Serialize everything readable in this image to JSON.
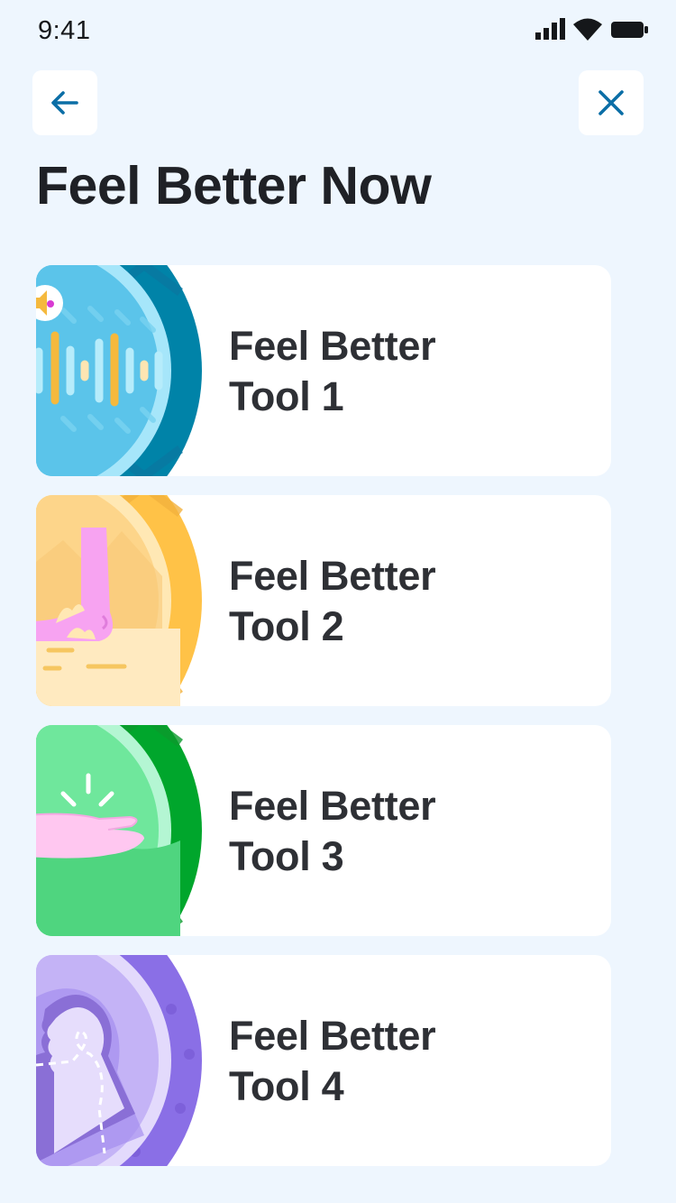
{
  "status_bar": {
    "time": "9:41",
    "icons": [
      "cellular-signal-icon",
      "wifi-icon",
      "battery-icon"
    ]
  },
  "nav": {
    "back_icon": "arrow-left-icon",
    "close_icon": "close-icon"
  },
  "page": {
    "title": "Feel Better Now"
  },
  "tools": [
    {
      "line1": "Feel Better",
      "line2": "Tool 1",
      "icon": "sound-wave-icon",
      "color": "#0083a8"
    },
    {
      "line1": "Feel Better",
      "line2": "Tool 2",
      "icon": "foot-on-ground-icon",
      "color": "#ffc247"
    },
    {
      "line1": "Feel Better",
      "line2": "Tool 3",
      "icon": "open-hand-icon",
      "color": "#00a62c"
    },
    {
      "line1": "Feel Better",
      "line2": "Tool 4",
      "icon": "head-profile-icon",
      "color": "#8a6fe6"
    }
  ],
  "colors": {
    "background": "#eef6fe",
    "card": "#ffffff",
    "accent": "#0b6ea6",
    "title_text": "#1f2126"
  }
}
